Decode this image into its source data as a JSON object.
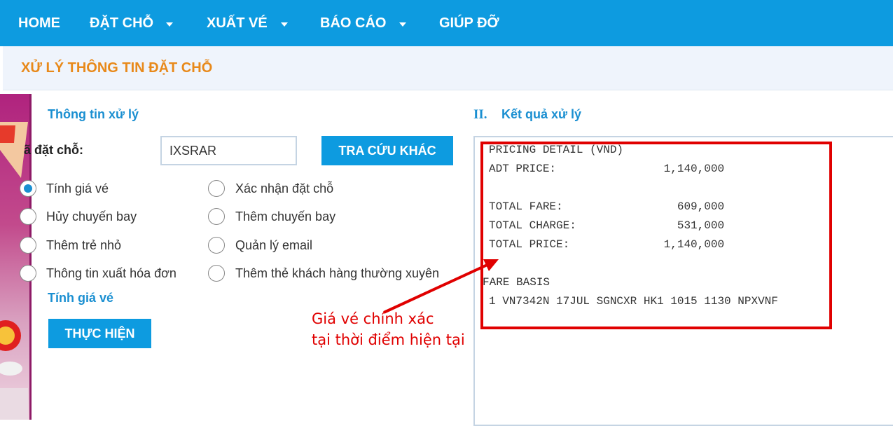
{
  "nav": {
    "home": "HOME",
    "booking": "ĐẶT CHỖ",
    "ticketing": "XUẤT VÉ",
    "reports": "BÁO CÁO",
    "help": "GIÚP ĐỠ"
  },
  "page_title": "XỬ LÝ THÔNG TIN ĐẶT CHỖ",
  "left_panel": {
    "section_title": "Thông tin xử lý",
    "booking_code_label": "ã đặt chỗ:",
    "booking_code_value": "IXSRAR",
    "lookup_button": "TRA CỨU KHÁC",
    "options": [
      {
        "label": "Tính giá vé"
      },
      {
        "label": "Xác nhận đặt chỗ"
      },
      {
        "label": "Hủy chuyến bay"
      },
      {
        "label": "Thêm chuyến bay"
      },
      {
        "label": "Thêm trẻ nhỏ"
      },
      {
        "label": "Quản lý email"
      },
      {
        "label": "Thông tin xuất hóa đơn"
      },
      {
        "label": "Thêm thẻ khách hàng thường xuyên"
      }
    ],
    "selected_action": "Tính giá vé",
    "execute_button": "THỰC HIỆN"
  },
  "right_panel": {
    "section_number": "II.",
    "section_title": "Kết quả xử lý",
    "result_lines": {
      "header": "PRICING DETAIL (VND)",
      "adt_price": "ADT PRICE:                1,140,000",
      "total_fare": "TOTAL FARE:                 609,000",
      "total_charge": "TOTAL CHARGE:               531,000",
      "total_price": "TOTAL PRICE:              1,140,000",
      "fare_basis_header": "FARE BASIS",
      "fare_basis_line": "1 VN7342N 17JUL SGNCXR HK1 1015 1130 NPXVNF"
    }
  },
  "annotation": {
    "line1": "Giá vé chính xác",
    "line2": "tại thời điểm hiện tại",
    "color": "#e00000"
  },
  "colors": {
    "nav_bg": "#0d9be0",
    "title": "#e8891a",
    "section": "#1a8fd1"
  }
}
